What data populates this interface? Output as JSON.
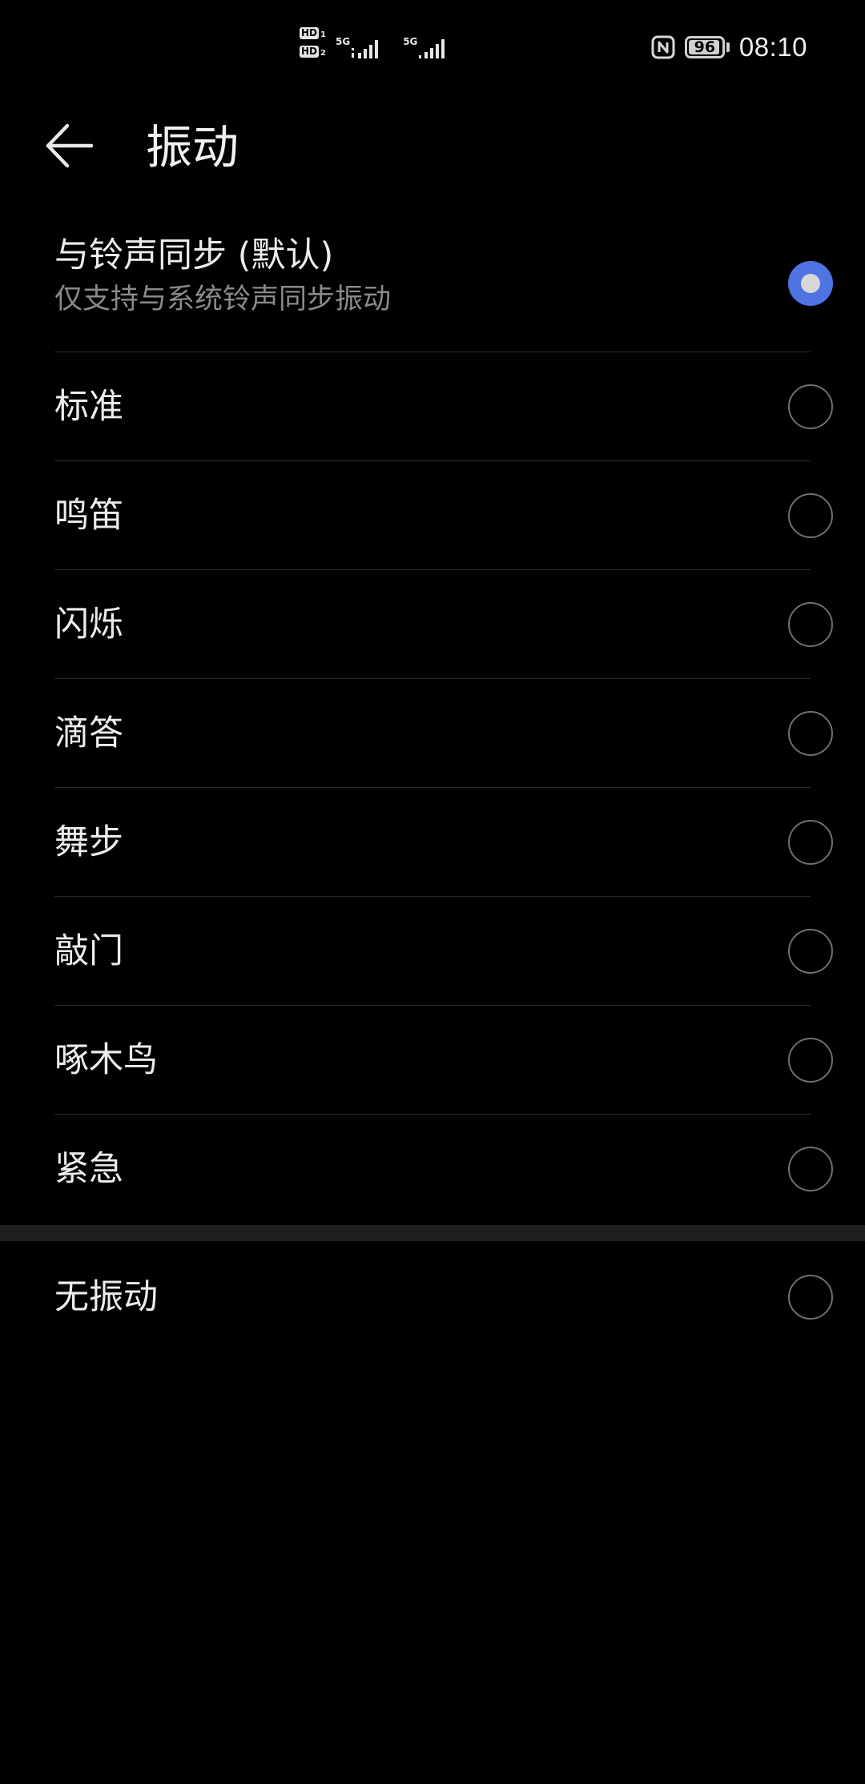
{
  "status_bar": {
    "sim1_badge": "HD",
    "sim1_index": "1",
    "sim2_badge": "HD",
    "sim2_index": "2",
    "sim1_network": "5G",
    "sim2_network": "5G",
    "battery_level": "96",
    "battery_fraction": 0.96,
    "time": "08:10",
    "icons": [
      "hd-volte-icon",
      "signal-strength-icon",
      "nfc-icon",
      "battery-icon"
    ]
  },
  "header": {
    "back_icon": "arrow-left-icon",
    "title": "振动"
  },
  "options": [
    {
      "label": "与铃声同步 (默认)",
      "sublabel": "仅支持与系统铃声同步振动",
      "selected": true
    },
    {
      "label": "标准",
      "selected": false
    },
    {
      "label": "鸣笛",
      "selected": false
    },
    {
      "label": "闪烁",
      "selected": false
    },
    {
      "label": "滴答",
      "selected": false
    },
    {
      "label": "舞步",
      "selected": false
    },
    {
      "label": "敲门",
      "selected": false
    },
    {
      "label": "啄木鸟",
      "selected": false
    },
    {
      "label": "紧急",
      "selected": false
    }
  ],
  "no_vibration": {
    "label": "无振动",
    "selected": false
  },
  "colors": {
    "background": "#000000",
    "accent": "#4f73e3",
    "primary_text": "#ececec",
    "secondary_text": "#8a8a8a",
    "divider": "#2b2b2b",
    "section_gap": "#1f1f1f"
  }
}
